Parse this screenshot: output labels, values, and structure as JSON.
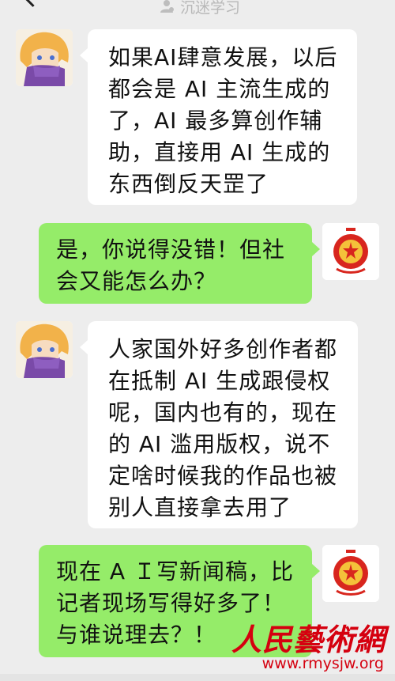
{
  "header": {
    "watermark_text": "沉迷学习",
    "watermark_icon": "user-profile-icon"
  },
  "messages": [
    {
      "side": "in",
      "avatar": "anime-avatar",
      "text": "如果AI肆意发展，以后都会是 AI 主流生成的了，AI 最多算创作辅助，直接用 AI 生成的东西倒反天罡了"
    },
    {
      "side": "out",
      "avatar": "national-emblem-avatar",
      "text": "是，你说得没错！但社会又能怎么办？"
    },
    {
      "side": "in",
      "avatar": "anime-avatar",
      "text": "人家国外好多创作者都在抵制 AI 生成跟侵权呢，国内也有的，现在的 AI 滥用版权，说不定啥时候我的作品也被别人直接拿去用了"
    },
    {
      "side": "out",
      "avatar": "national-emblem-avatar",
      "text": "现在 A Ｉ写新闻稿，比记者现场写得好多了！与谁说理去？！"
    }
  ],
  "watermark": {
    "name": "人民藝術網",
    "url": "www.rmysjw.org"
  },
  "colors": {
    "background": "#ededed",
    "incoming_bubble": "#ffffff",
    "outgoing_bubble": "#95ec69",
    "watermark_red": "#d5000f"
  }
}
